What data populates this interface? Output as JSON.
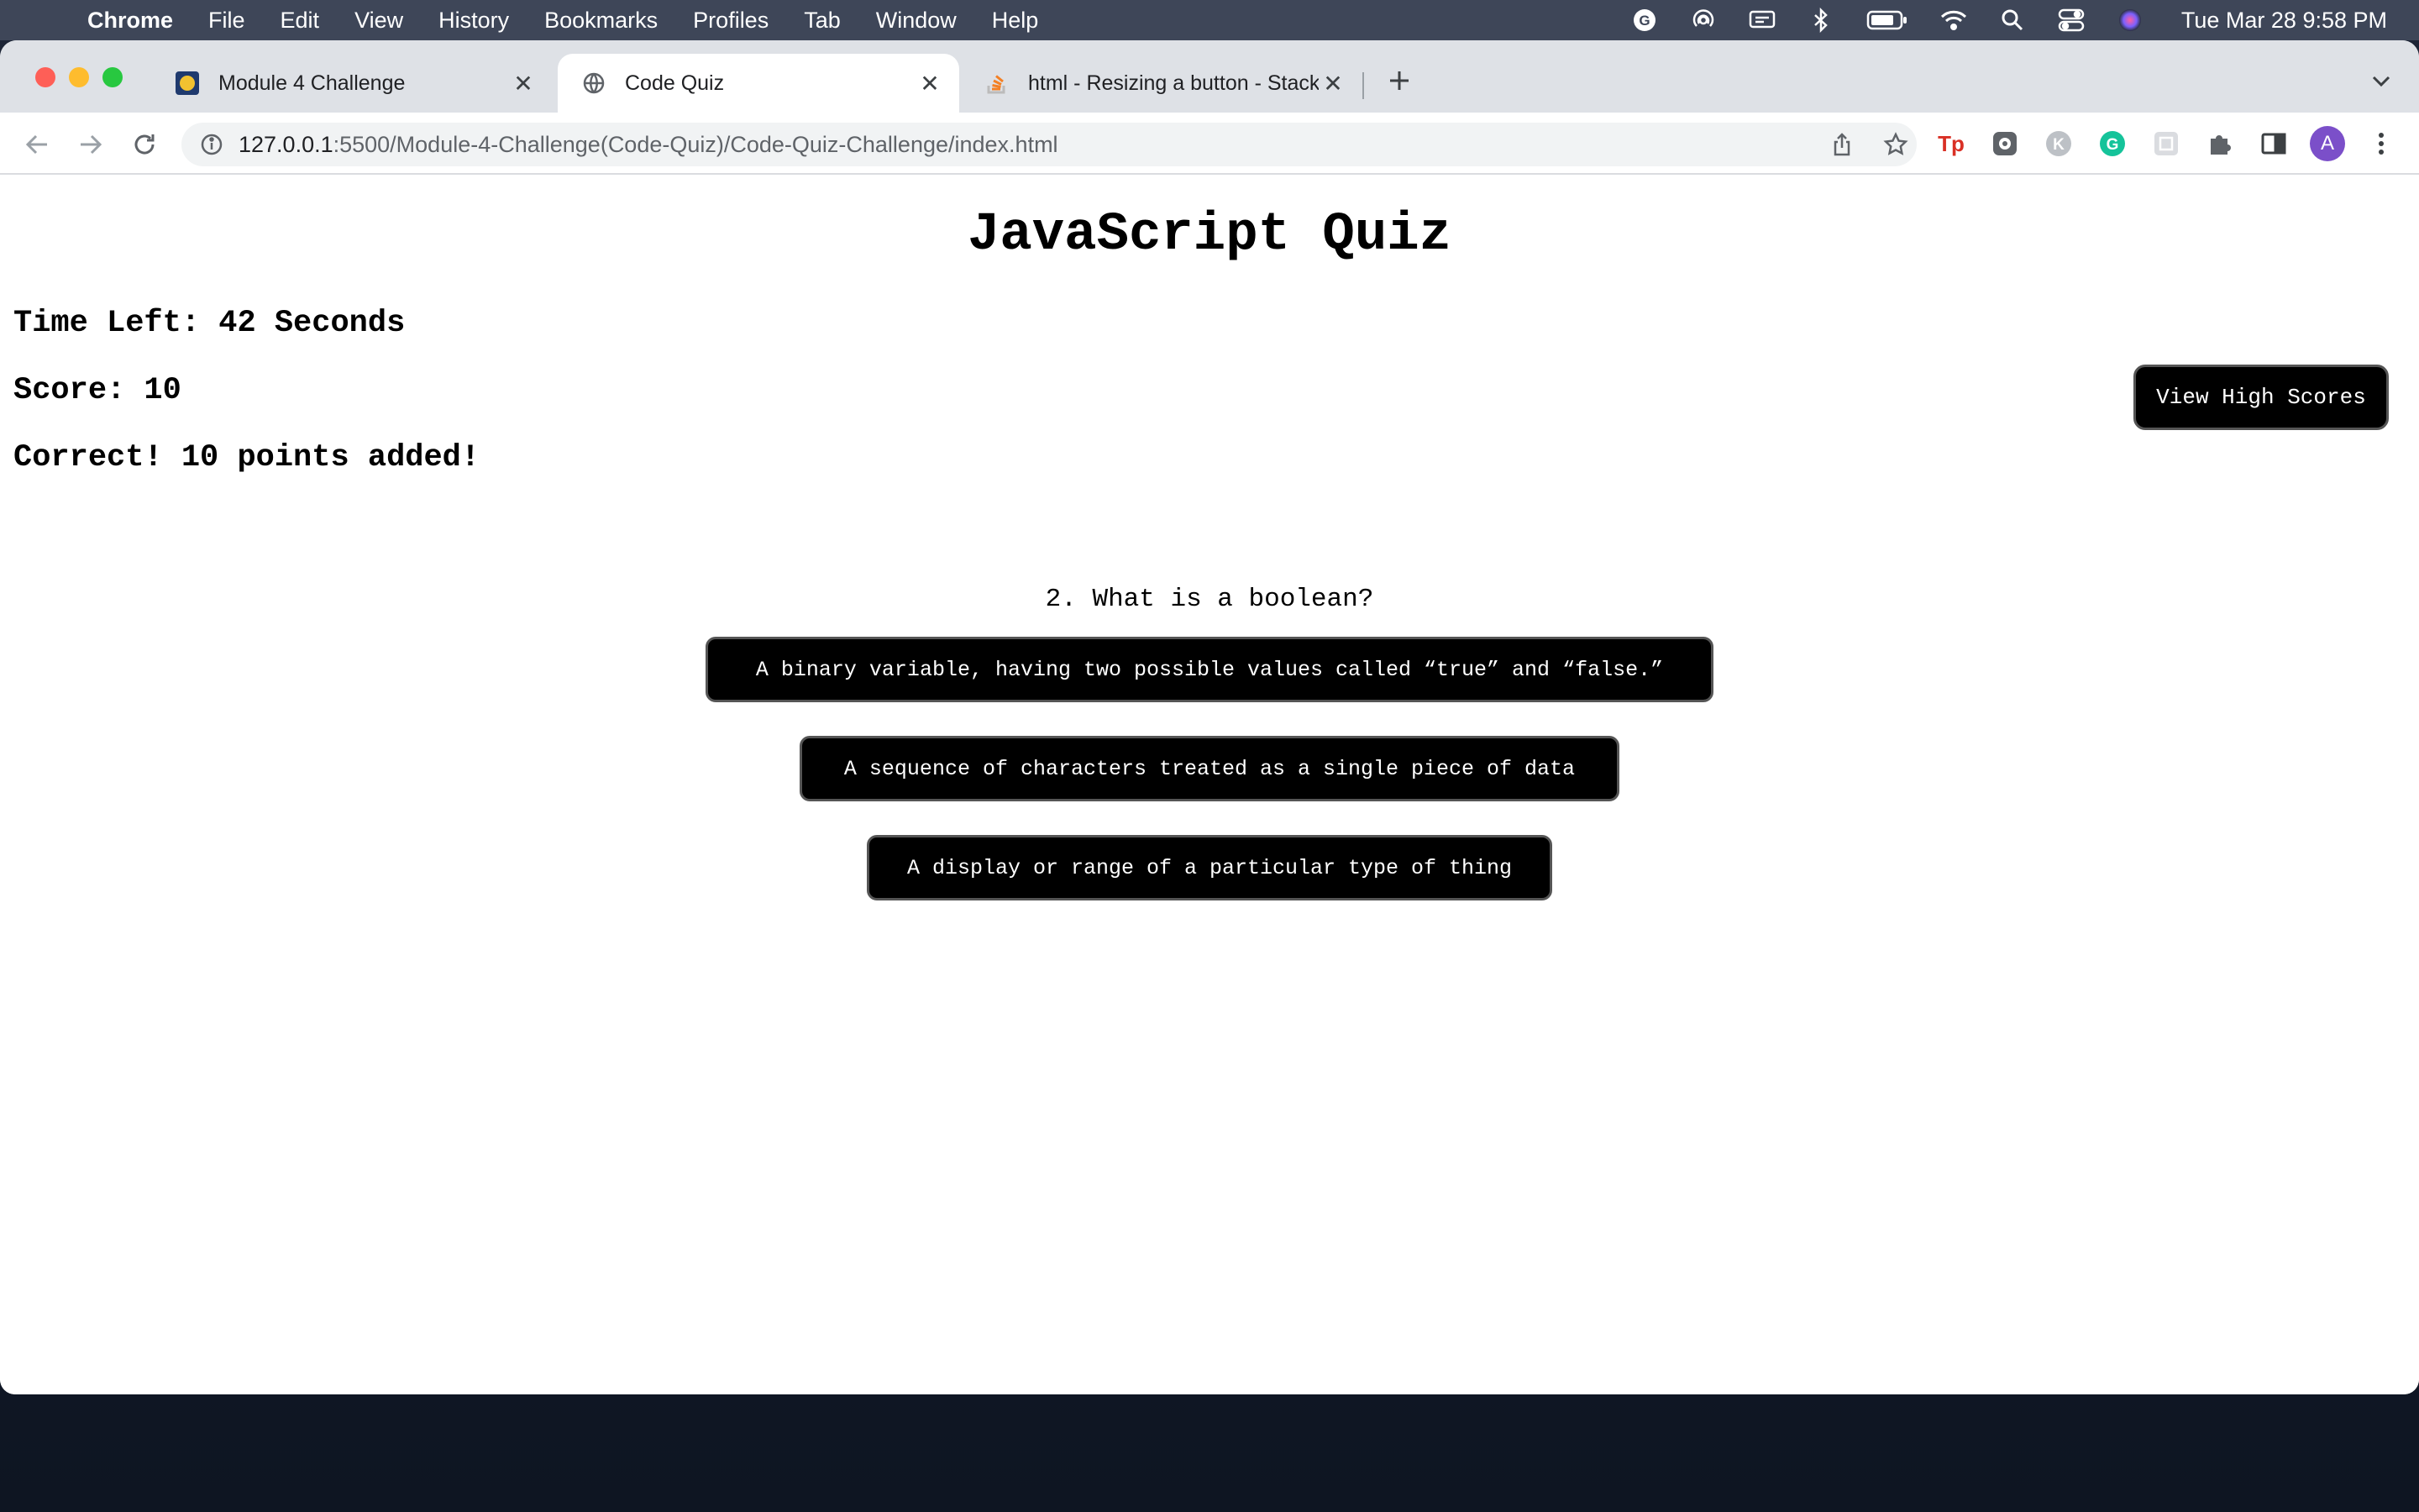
{
  "menubar": {
    "app": "Chrome",
    "items": [
      "File",
      "Edit",
      "View",
      "History",
      "Bookmarks",
      "Profiles",
      "Tab",
      "Window",
      "Help"
    ],
    "clock": "Tue Mar 28  9:58 PM"
  },
  "tabs": [
    {
      "title": "Module 4 Challenge"
    },
    {
      "title": "Code Quiz"
    },
    {
      "title": "html - Resizing a button - Stack"
    }
  ],
  "address": {
    "host": "127.0.0.1",
    "path": ":5500/Module-4-Challenge(Code-Quiz)/Code-Quiz-Challenge/index.html"
  },
  "profile": {
    "initial": "A"
  },
  "quiz": {
    "title": "JavaScript Quiz",
    "time_left": "Time Left: 42 Seconds",
    "score": "Score: 10",
    "feedback": "Correct! 10 points added!",
    "high_scores_label": "View High Scores",
    "question": "2. What is a boolean?",
    "answers": [
      "A binary variable, having two possible values called “true” and “false.”",
      "A sequence of characters treated as a single piece of data",
      "A display or range of a particular type of thing"
    ]
  },
  "colors": {
    "menubar_bg": "#3e4658",
    "tabstrip_bg": "#dee1e6",
    "button_bg": "#000000",
    "button_text": "#ffffff"
  }
}
